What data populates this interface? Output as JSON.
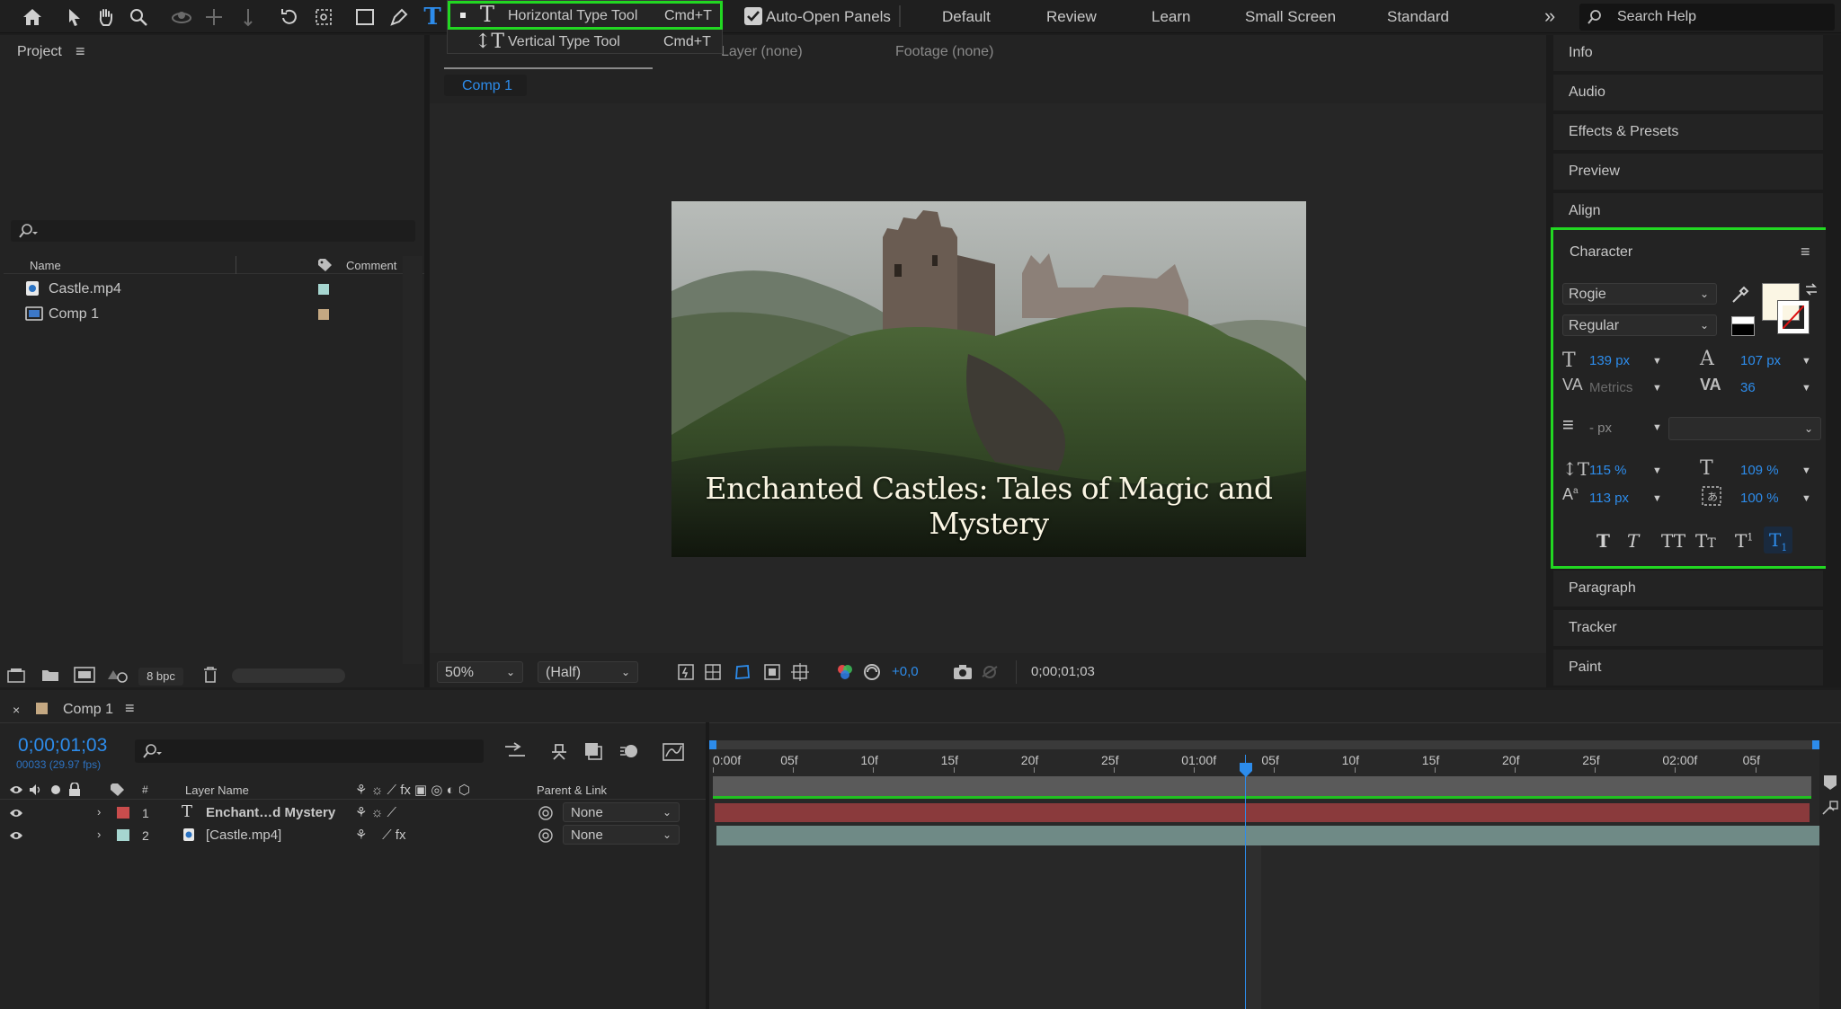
{
  "toolbar": {
    "tools": [
      "home-icon",
      "select-icon",
      "hand-icon",
      "zoom-icon",
      "orbit-icon",
      "pan-icon",
      "dolly-icon",
      "rotate-icon",
      "anchor-icon",
      "rectangle-icon",
      "pen-icon",
      "type-icon"
    ],
    "auto_open_panels": "Auto-Open Panels",
    "workspaces": [
      "Default",
      "Review",
      "Learn",
      "Small Screen",
      "Standard"
    ],
    "search_placeholder": "Search Help"
  },
  "type_menu": {
    "items": [
      {
        "label": "Horizontal Type Tool",
        "shortcut": "Cmd+T"
      },
      {
        "label": "Vertical Type Tool",
        "shortcut": "Cmd+T"
      }
    ]
  },
  "project": {
    "title": "Project",
    "col_name": "Name",
    "col_comment": "Comment",
    "items": [
      {
        "name": "Castle.mp4",
        "color": "#a6d6d0"
      },
      {
        "name": "Comp 1",
        "color": "#c4a882"
      }
    ],
    "bpc": "8 bpc"
  },
  "viewer": {
    "tabs": [
      "Layer (none)",
      "Footage (none)"
    ],
    "comp_tab": "Comp 1",
    "title_text": "Enchanted Castles: Tales of Magic and Mystery",
    "zoom": "50%",
    "resolution": "(Half)",
    "exposure": "+0,0",
    "timecode": "0;00;01;03"
  },
  "right_panels": {
    "top": [
      "Info",
      "Audio",
      "Effects & Presets",
      "Preview",
      "Align"
    ],
    "bottom": [
      "Paragraph",
      "Tracker",
      "Paint"
    ]
  },
  "character": {
    "title": "Character",
    "font": "Rogie",
    "style": "Regular",
    "size": "139 px",
    "leading": "107 px",
    "kerning": "Metrics",
    "tracking": "36",
    "stroke_width": "- px",
    "vscale": "115 %",
    "hscale": "109 %",
    "baseline": "113 px",
    "tsume": "100 %",
    "fill_color": "#fbf6e4"
  },
  "timeline": {
    "tab": "Comp 1",
    "timecode": "0;00;01;03",
    "frames": "00033 (29.97 fps)",
    "cols": {
      "num": "#",
      "layer": "Layer Name",
      "parent": "Parent & Link"
    },
    "ruler": [
      "0:00f",
      "05f",
      "10f",
      "15f",
      "20f",
      "25f",
      "01:00f",
      "05f",
      "10f",
      "15f",
      "20f",
      "25f",
      "02:00f",
      "05f"
    ],
    "layers": [
      {
        "num": "1",
        "name": "Enchant…d Mystery",
        "parent": "None",
        "color": "#c94c4c",
        "bar": "#8a3a3c"
      },
      {
        "num": "2",
        "name": "[Castle.mp4]",
        "parent": "None",
        "color": "#a6d6d0",
        "bar": "#6f8a86"
      }
    ]
  }
}
